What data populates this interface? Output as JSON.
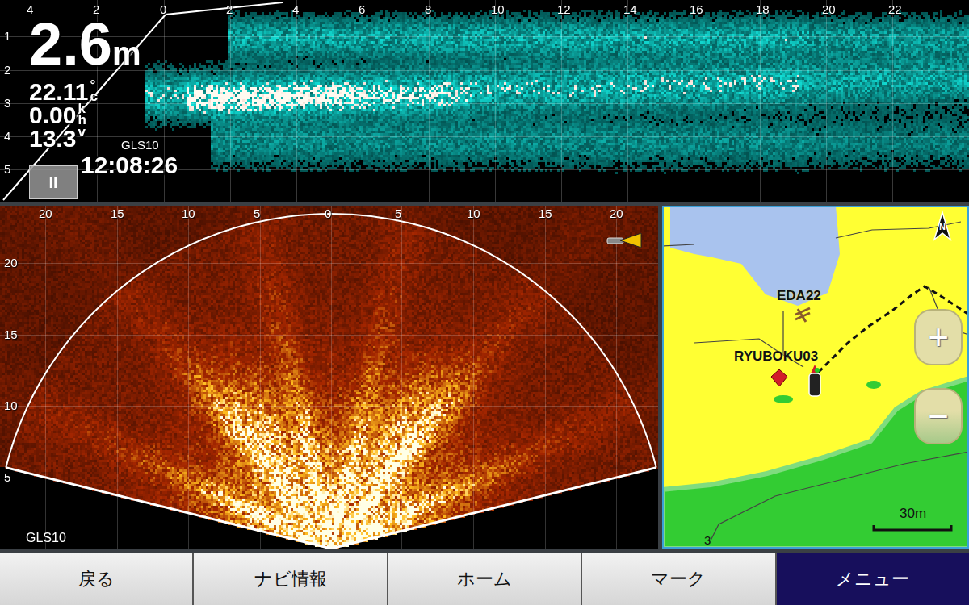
{
  "depth_view": {
    "device": "GLS10",
    "depth": "2.6",
    "depth_unit": "m",
    "water_temp": "22.11",
    "temp_unit_top": "°",
    "temp_unit_bottom": "c",
    "speed": "0.00",
    "speed_unit_top": "k",
    "speed_unit_bottom": "h",
    "voltage": "13.3",
    "voltage_unit": "v",
    "time": "12:08:26",
    "pause_button": "II",
    "x_ticks": [
      "4",
      "2",
      "0",
      "2",
      "4",
      "6",
      "8",
      "10",
      "12",
      "14",
      "16",
      "18",
      "20",
      "22"
    ],
    "y_ticks": [
      "1",
      "2",
      "3",
      "4",
      "5"
    ]
  },
  "forward_view": {
    "device": "GLS10",
    "x_ticks": [
      "20",
      "15",
      "10",
      "5",
      "0",
      "5",
      "10",
      "15",
      "20"
    ],
    "y_ticks": [
      "20",
      "15",
      "10",
      "5"
    ]
  },
  "map": {
    "north": "N",
    "waypoints": [
      {
        "label": "EDA22"
      },
      {
        "label": "RYUBOKU03"
      }
    ],
    "zoom_in": "+",
    "zoom_out": "−",
    "scale": "30m",
    "contour_label": "3"
  },
  "softkeys": [
    {
      "label": "戻る",
      "selected": false
    },
    {
      "label": "ナビ情報",
      "selected": false
    },
    {
      "label": "ホーム",
      "selected": false
    },
    {
      "label": "マーク",
      "selected": false
    },
    {
      "label": "メニュー",
      "selected": true
    }
  ]
}
